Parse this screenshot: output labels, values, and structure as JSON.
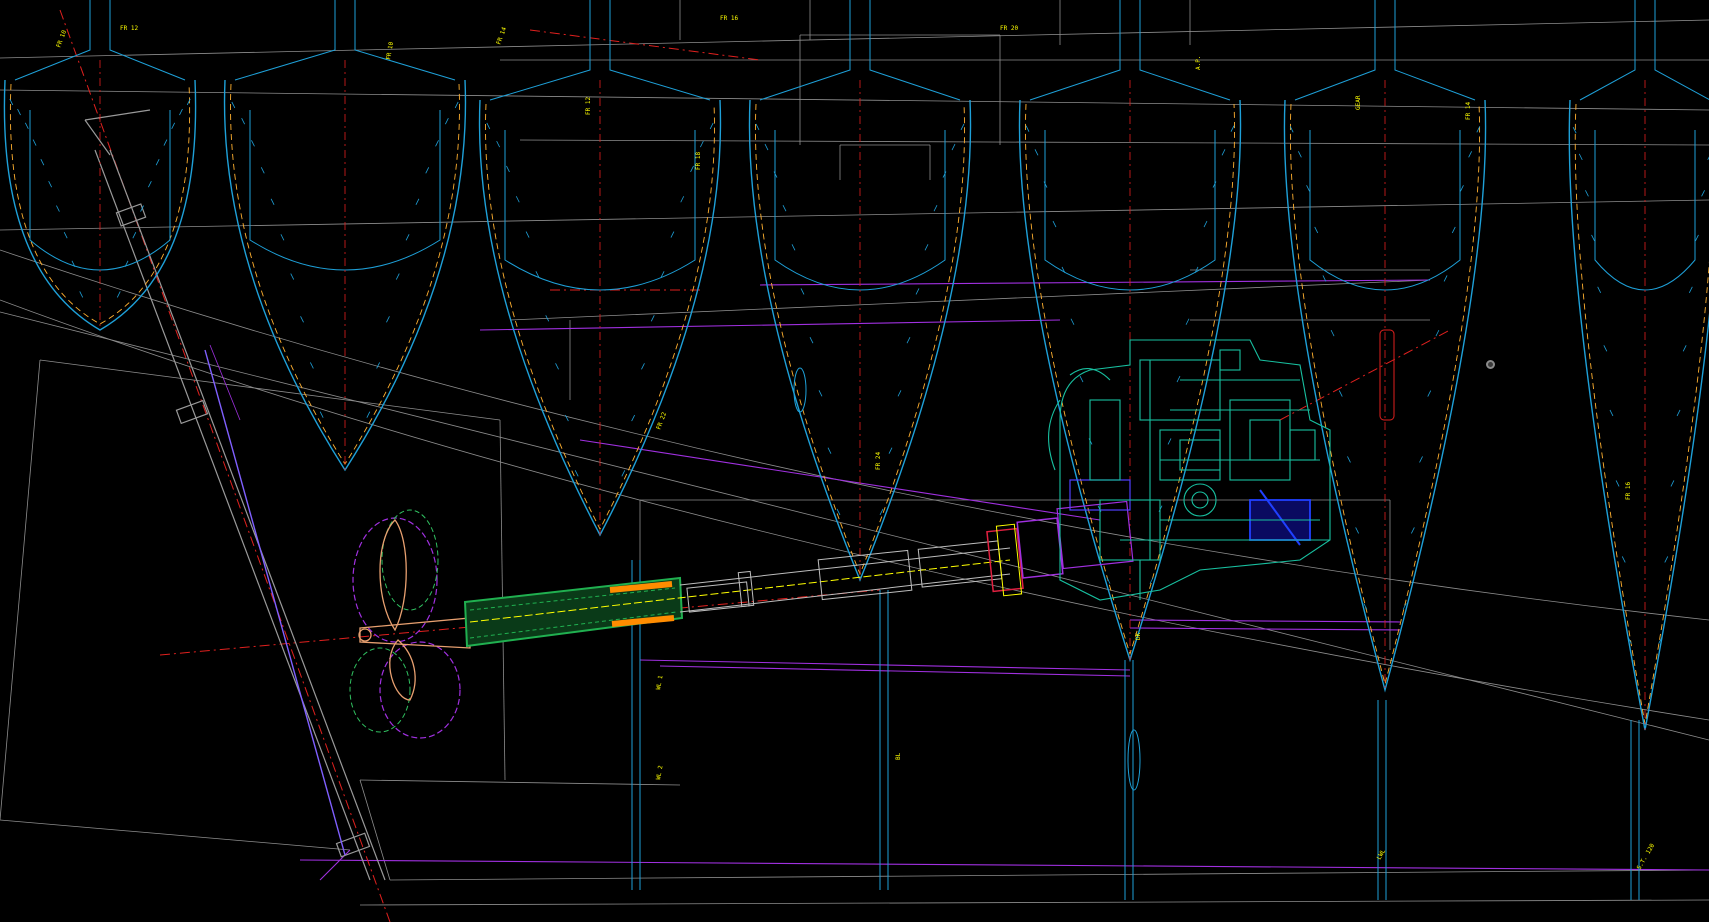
{
  "app": {
    "title": "",
    "background": "#000000"
  },
  "palette": {
    "hull": "#1ea0d8",
    "hull_dashed": "#ffb030",
    "construction": "#bdbdbd",
    "centerline": "#e0201e",
    "deck": "#a030e0",
    "engine": "#18c0a0",
    "shaft_tube": "#20b050",
    "propeller": "#e8a070",
    "annotation": "#ffff00",
    "gearbox": "#e02040",
    "coupling": "#2040ff"
  },
  "view": {
    "frames_count": 8,
    "pivot_marker": "view-pivot"
  },
  "annotations": [
    "FR 10",
    "FR 12",
    "FR 14",
    "FR 16",
    "FR 18",
    "FR 20",
    "FR 22",
    "FR 24",
    "WL 1",
    "WL 2",
    "BL",
    "DK",
    "LWL",
    "S.T. 120",
    "A.P.",
    "GEAR"
  ]
}
